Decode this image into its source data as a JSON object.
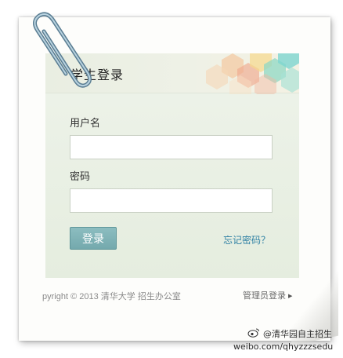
{
  "panel": {
    "title": "学生登录",
    "username_label": "用户名",
    "username_value": "",
    "password_label": "密码",
    "password_value": "",
    "login_button": "登录",
    "forgot_link": "忘记密码？"
  },
  "footer": {
    "copyright": "pyright © 2013 清华大学  招生办公室",
    "admin_login": "管理员登录",
    "admin_arrow": "▶"
  },
  "watermark": {
    "handle": "@清华园自主招生",
    "url": "weibo.com/qhyzzzsedu"
  },
  "colors": {
    "accent_button": "#7fb3b6",
    "link": "#2e80a3",
    "panel_bg": "#e9efe4"
  }
}
